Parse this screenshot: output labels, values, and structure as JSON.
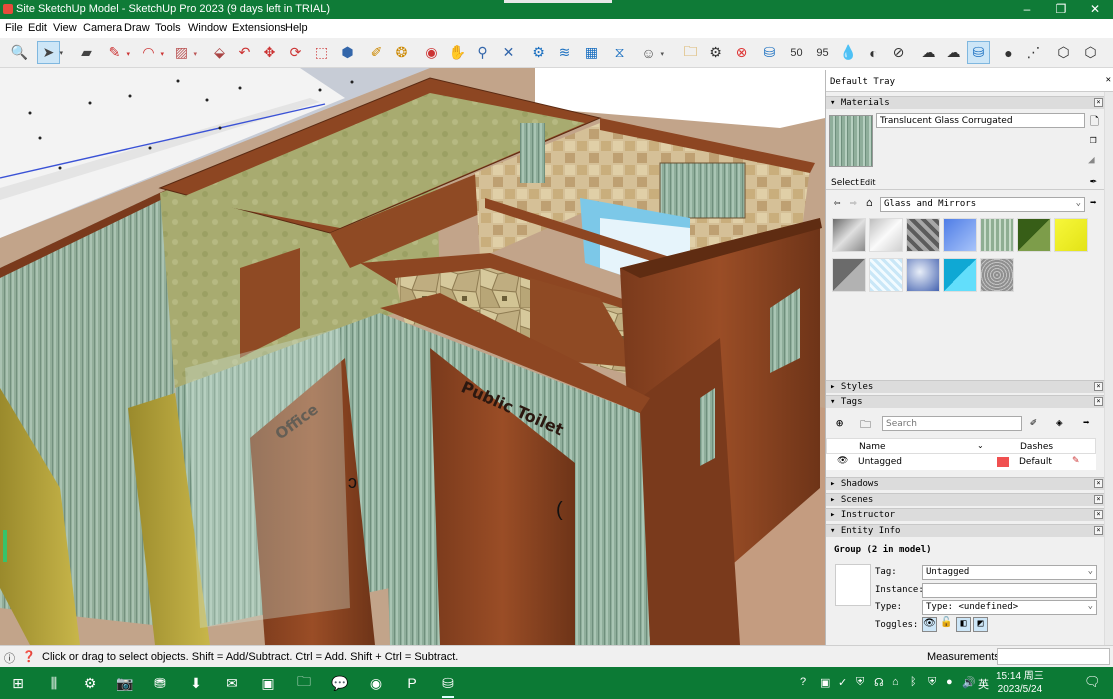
{
  "window": {
    "title": "Site SketchUp Model - SketchUp Pro 2023 (9 days left in TRIAL)",
    "minimize": "–",
    "maximize": "❐",
    "close": "✕"
  },
  "menu": [
    "File",
    "Edit",
    "View",
    "Camera",
    "Draw",
    "Tools",
    "Window",
    "Extensions",
    "Help"
  ],
  "toolbar_icons": [
    "zoom-extents-icon",
    "select-icon",
    "eraser-icon",
    "line-icon",
    "arc-icon",
    "shape-icon",
    "push-pull-icon",
    "offset-icon",
    "move-icon",
    "rotate-icon",
    "scale-icon",
    "tape-measure-icon",
    "paint-bucket-icon",
    "orbit-icon",
    "pan-icon",
    "zoom-icon",
    "zoom-window-icon",
    "3d-warehouse-icon",
    "extension-warehouse-icon",
    "layout-icon",
    "styles-icon",
    "account-icon",
    "open-folder-icon",
    "settings-gear-icon",
    "error-circle-icon",
    "sandbox-icon",
    "speed-50-icon",
    "speed-95-icon",
    "water-drop-icon",
    "contrast-icon",
    "hatched-circle-icon",
    "cloud-download-icon",
    "cloud-upload-icon",
    "component-icon",
    "dot-icon",
    "dashed-line-icon",
    "hexagon-icon",
    "hexagon-alt-icon"
  ],
  "viewport": {
    "door_labels": [
      "Office",
      "Public Toilet"
    ]
  },
  "tray": {
    "title": "Default Tray",
    "materials": {
      "header": "Materials",
      "current_material": "Translucent Glass Corrugated",
      "tab_select": "Select",
      "tab_edit": "Edit",
      "library": "Glass and Mirrors",
      "swatch_colors": [
        "#9a9a9a",
        "#d8d8d8",
        "#6c6c6c",
        "#7fa6f0",
        "#8fae92",
        "#4f7a2a",
        "#f2f232",
        "#8a8a8a",
        "#c9e7f7",
        "#6a86c8",
        "#35c9ec",
        "#b8b8b8"
      ]
    },
    "styles_header": "Styles",
    "tags": {
      "header": "Tags",
      "search_placeholder": "Search",
      "col_name": "Name",
      "col_dashes": "Dashes",
      "row_name": "Untagged",
      "row_dashes": "Default",
      "row_color": "#f05050"
    },
    "shadows_header": "Shadows",
    "scenes_header": "Scenes",
    "instructor_header": "Instructor",
    "entity_info": {
      "header": "Entity Info",
      "summary": "Group (2 in model)",
      "tag_label": "Tag:",
      "tag_value": "Untagged",
      "instance_label": "Instance:",
      "instance_value": "",
      "type_label": "Type:",
      "type_value": "Type: <undefined>",
      "toggles_label": "Toggles:"
    }
  },
  "status": {
    "message": "Click or drag to select objects. Shift = Add/Subtract. Ctrl = Add. Shift + Ctrl = Subtract.",
    "measurements_label": "Measurements",
    "measurements_value": ""
  },
  "taskbar": {
    "time": "15:14 周三",
    "date": "2023/5/24",
    "ime": "英"
  }
}
